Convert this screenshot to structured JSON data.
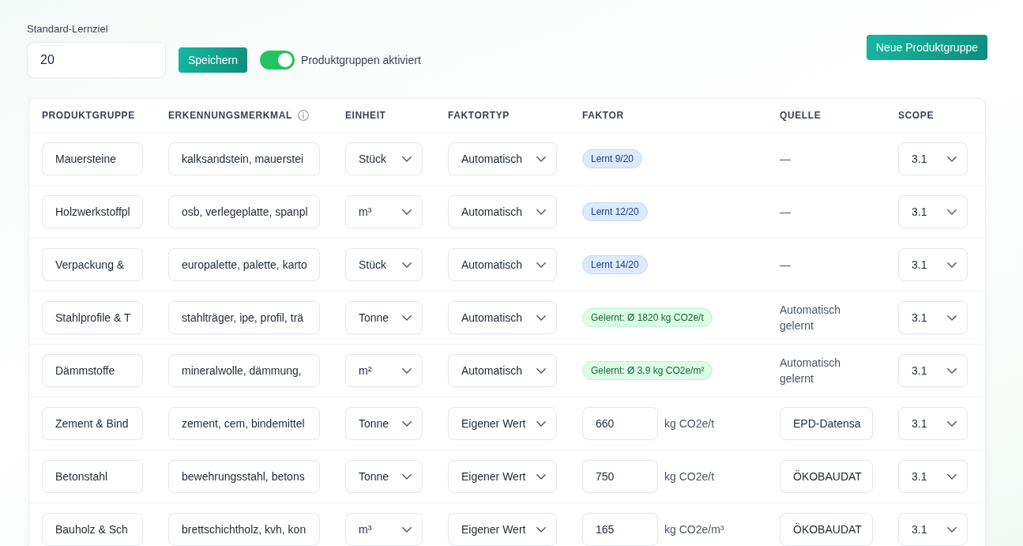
{
  "learning_target": {
    "label": "Standard-Lernziel",
    "value": "20"
  },
  "save_button": "Speichern",
  "groups_toggle": {
    "label": "Produktgruppen aktiviert",
    "on": true
  },
  "new_group_button": "Neue Produktgruppe",
  "table": {
    "columns": [
      {
        "label": "PRODUKTGRUPPE"
      },
      {
        "label": "ERKENNUNGSMERKMAL",
        "info": true
      },
      {
        "label": "EINHEIT"
      },
      {
        "label": "FAKTORTYP"
      },
      {
        "label": "FAKTOR"
      },
      {
        "label": "QUELLE"
      },
      {
        "label": "SCOPE"
      }
    ],
    "rows": [
      {
        "name": "Mauersteine",
        "keywords": "kalksandstein, mauerstei",
        "unit": "Stück",
        "factor_type": "Automatisch",
        "factor": {
          "kind": "learning",
          "text": "Lernt 9/20"
        },
        "source": {
          "kind": "text",
          "text": "—"
        },
        "scope": "3.1"
      },
      {
        "name": "Holzwerkstoffpl",
        "keywords": "osb, verlegeplatte, spanpl",
        "unit": "m³",
        "factor_type": "Automatisch",
        "factor": {
          "kind": "learning",
          "text": "Lernt 12/20"
        },
        "source": {
          "kind": "text",
          "text": "—"
        },
        "scope": "3.1"
      },
      {
        "name": "Verpackung &",
        "keywords": "europalette, palette, karto",
        "unit": "Stück",
        "factor_type": "Automatisch",
        "factor": {
          "kind": "learning",
          "text": "Lernt 14/20"
        },
        "source": {
          "kind": "text",
          "text": "—"
        },
        "scope": "3.1"
      },
      {
        "name": "Stahlprofile & T",
        "keywords": "stahlträger, ipe, profil, trä",
        "unit": "Tonne",
        "factor_type": "Automatisch",
        "factor": {
          "kind": "learned",
          "text": "Gelernt: Ø 1820 kg CO2e/t"
        },
        "source": {
          "kind": "text",
          "text": "Automatisch gelernt"
        },
        "scope": "3.1"
      },
      {
        "name": "Dämmstoffe",
        "keywords": "mineralwolle, dämmung,",
        "unit": "m²",
        "factor_type": "Automatisch",
        "factor": {
          "kind": "learned",
          "text": "Gelernt: Ø 3.9 kg CO2e/m²"
        },
        "source": {
          "kind": "text",
          "text": "Automatisch gelernt"
        },
        "scope": "3.1"
      },
      {
        "name": "Zement & Bind",
        "keywords": "zement, cem, bindemittel",
        "unit": "Tonne",
        "factor_type": "Eigener Wert",
        "factor": {
          "kind": "custom",
          "value": "660",
          "unit": "kg CO2e/t"
        },
        "source": {
          "kind": "input",
          "text": "EPD-Datensa"
        },
        "scope": "3.1"
      },
      {
        "name": "Betonstahl",
        "keywords": "bewehrungsstahl, betons",
        "unit": "Tonne",
        "factor_type": "Eigener Wert",
        "factor": {
          "kind": "custom",
          "value": "750",
          "unit": "kg CO2e/t"
        },
        "source": {
          "kind": "input",
          "text": "ÖKOBAUDAT"
        },
        "scope": "3.1"
      },
      {
        "name": "Bauholz & Sch",
        "keywords": "brettschichtholz, kvh, kon",
        "unit": "m³",
        "factor_type": "Eigener Wert",
        "factor": {
          "kind": "custom",
          "value": "165",
          "unit": "kg CO2e/m³"
        },
        "source": {
          "kind": "input",
          "text": "ÖKOBAUDAT"
        },
        "scope": "3.1"
      }
    ]
  }
}
